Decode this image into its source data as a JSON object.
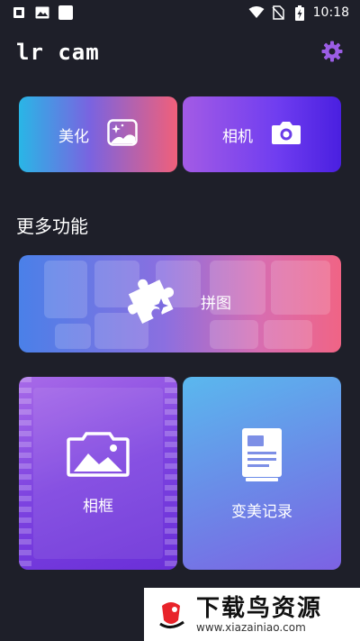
{
  "status_bar": {
    "time": "10:18",
    "icons": [
      "app-notification-icon",
      "image-notification-icon",
      "blank-notification-icon",
      "wifi-icon",
      "no-sim-icon",
      "battery-charging-icon"
    ]
  },
  "header": {
    "title": "lr cam",
    "settings_icon": "gear-icon"
  },
  "quick_actions": {
    "beautify_label": "美化",
    "beautify_icon": "sparkle-image-icon",
    "camera_label": "相机",
    "camera_icon": "camera-icon"
  },
  "more_features": {
    "title": "更多功能",
    "collage_label": "拼图",
    "collage_icon": "puzzle-icon",
    "frame_label": "相框",
    "frame_icon": "landscape-frame-icon",
    "record_label": "变美记录",
    "record_icon": "document-icon"
  },
  "watermark": {
    "brand": "下载鸟资源",
    "url": "www.xiazainiao.com"
  },
  "colors": {
    "background": "#1e1f29",
    "accent_purple": "#9b5de5",
    "gear": "#9b5de5"
  }
}
